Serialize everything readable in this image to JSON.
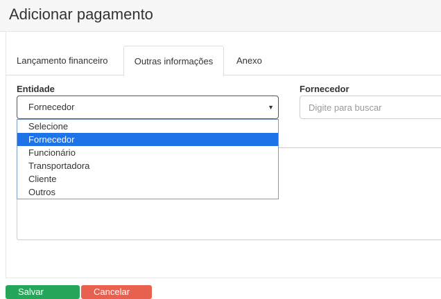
{
  "header": {
    "title": "Adicionar pagamento"
  },
  "tabs": [
    {
      "label": "Lançamento financeiro"
    },
    {
      "label": "Outras informações"
    },
    {
      "label": "Anexo"
    }
  ],
  "form": {
    "entidade_label": "Entidade",
    "entidade_value": "Fornecedor",
    "fornecedor_label": "Fornecedor",
    "fornecedor_placeholder": "Digite para buscar",
    "options": [
      "Selecione",
      "Fornecedor",
      "Funcionário",
      "Transportadora",
      "Cliente",
      "Outros"
    ],
    "selected_option": "Fornecedor"
  },
  "buttons": {
    "save_label": "Salvar",
    "cancel_label": "Cancelar"
  },
  "colors": {
    "selected_option": "#1e73e8",
    "save": "#26a65b",
    "cancel": "#e8604f"
  }
}
